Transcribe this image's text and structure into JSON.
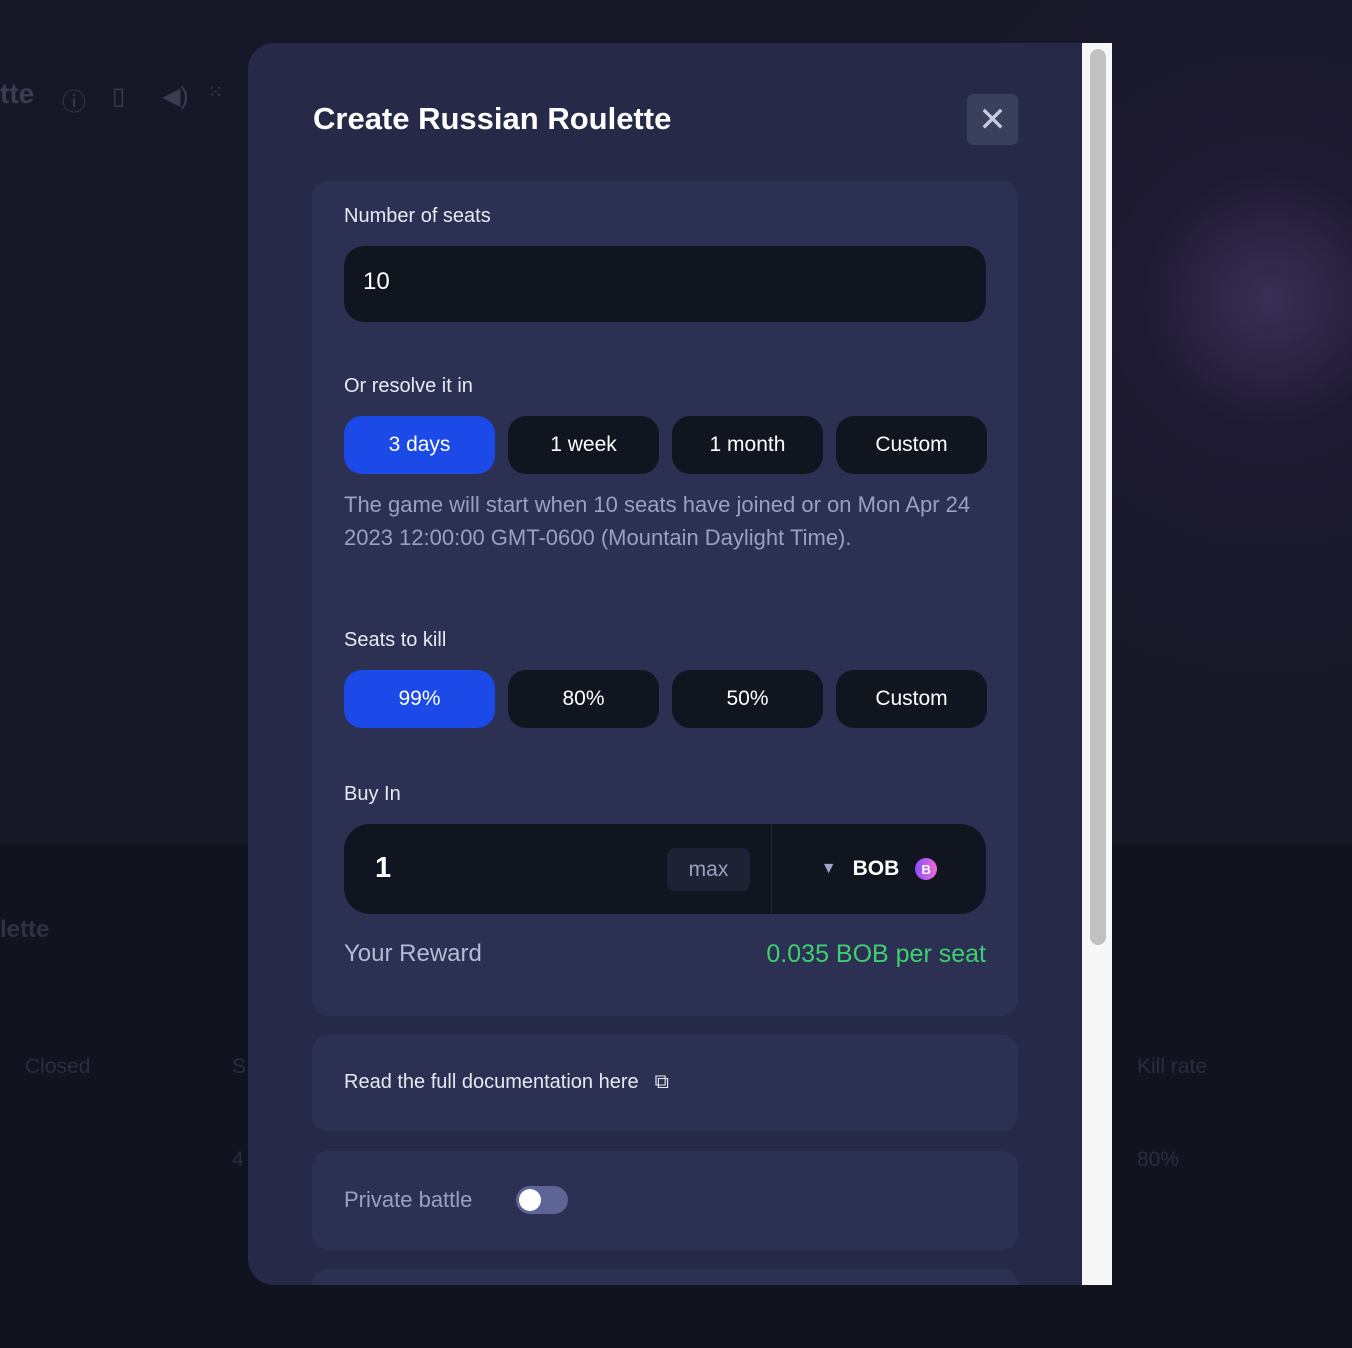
{
  "background": {
    "title": "tte",
    "title2": "lette",
    "closed": "Closed",
    "kill_rate": "Kill rate",
    "kill_rate_value": "80%",
    "partial_s": "S",
    "partial_4": "4"
  },
  "modal": {
    "title": "Create Russian Roulette",
    "seats": {
      "label": "Number of seats",
      "value": "10"
    },
    "resolve": {
      "label": "Or resolve it in",
      "options": [
        "3 days",
        "1 week",
        "1 month",
        "Custom"
      ],
      "selected": "3 days",
      "description": "The game will start when 10 seats have joined or on Mon Apr 24 2023 12:00:00 GMT-0600 (Mountain Daylight Time)."
    },
    "kill": {
      "label": "Seats to kill",
      "options": [
        "99%",
        "80%",
        "50%",
        "Custom"
      ],
      "selected": "99%"
    },
    "buyin": {
      "label": "Buy In",
      "value": "1",
      "max_label": "max",
      "token": "BOB",
      "token_badge": "B"
    },
    "reward": {
      "label": "Your Reward",
      "value": "0.035 BOB per seat"
    },
    "docs": {
      "label": "Read the full documentation here"
    },
    "private": {
      "label": "Private battle",
      "enabled": false
    }
  },
  "colors": {
    "accent": "#1c4ae8",
    "reward": "#3fcf72",
    "modal_bg": "#262a48"
  }
}
